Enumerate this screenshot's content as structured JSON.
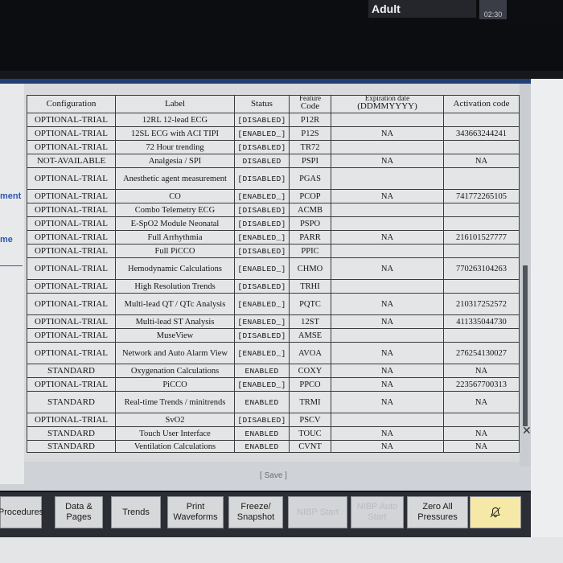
{
  "header": {
    "patient_type": "Adult",
    "clock": "02:30"
  },
  "left_pane": {
    "items": [
      "ment",
      "me"
    ]
  },
  "table": {
    "columns": [
      "Configuration",
      "Label",
      "Status",
      "Feature Code",
      "Expiration date (DDMMYYYY)",
      "Activation code"
    ],
    "column_display": {
      "configuration": "Configuration",
      "label": "Label",
      "status": "Status",
      "feature_code_top": "Feature",
      "feature_code_bottom": "Code",
      "expiration_top": "Expiration date",
      "expiration_bottom": "(DDMMYYYY)",
      "activation": "Activation code"
    },
    "rows": [
      {
        "config": "OPTIONAL-TRIAL",
        "label": "12RL 12-lead ECG",
        "status": "[DISABLED]",
        "code": "P12R",
        "expiration": "",
        "activation": ""
      },
      {
        "config": "OPTIONAL-TRIAL",
        "label": "12SL ECG with ACI TIPI",
        "status": "[ENABLED_]",
        "code": "P12S",
        "expiration": "NA",
        "activation": "343663244241"
      },
      {
        "config": "OPTIONAL-TRIAL",
        "label": "72 Hour trending",
        "status": "[DISABLED]",
        "code": "TR72",
        "expiration": "",
        "activation": ""
      },
      {
        "config": "NOT-AVAILABLE",
        "label": "Analgesia / SPI",
        "status": "DISABLED",
        "code": "PSPI",
        "expiration": "NA",
        "activation": "NA"
      },
      {
        "config": "OPTIONAL-TRIAL",
        "label": "Anesthetic agent measurement",
        "status": "[DISABLED]",
        "code": "PGAS",
        "expiration": "",
        "activation": ""
      },
      {
        "config": "OPTIONAL-TRIAL",
        "label": "CO",
        "status": "[ENABLED_]",
        "code": "PCOP",
        "expiration": "NA",
        "activation": "741772265105"
      },
      {
        "config": "OPTIONAL-TRIAL",
        "label": "Combo Telemetry ECG",
        "status": "[DISABLED]",
        "code": "ACMB",
        "expiration": "",
        "activation": ""
      },
      {
        "config": "OPTIONAL-TRIAL",
        "label": "E-SpO2 Module Neonatal",
        "status": "[DISABLED]",
        "code": "PSPO",
        "expiration": "",
        "activation": ""
      },
      {
        "config": "OPTIONAL-TRIAL",
        "label": "Full Arrhythmia",
        "status": "[ENABLED_]",
        "code": "PARR",
        "expiration": "NA",
        "activation": "216101527777"
      },
      {
        "config": "OPTIONAL-TRIAL",
        "label": "Full PiCCO",
        "status": "[DISABLED]",
        "code": "PPIC",
        "expiration": "",
        "activation": ""
      },
      {
        "config": "OPTIONAL-TRIAL",
        "label": "Hemodynamic Calculations",
        "status": "[ENABLED_]",
        "code": "CHMO",
        "expiration": "NA",
        "activation": "770263104263"
      },
      {
        "config": "OPTIONAL-TRIAL",
        "label": "High Resolution Trends",
        "status": "[DISABLED]",
        "code": "TRHI",
        "expiration": "",
        "activation": ""
      },
      {
        "config": "OPTIONAL-TRIAL",
        "label": "Multi-lead QT / QTc Analysis",
        "status": "[ENABLED_]",
        "code": "PQTC",
        "expiration": "NA",
        "activation": "210317252572"
      },
      {
        "config": "OPTIONAL-TRIAL",
        "label": "Multi-lead ST Analysis",
        "status": "[ENABLED_]",
        "code": "12ST",
        "expiration": "NA",
        "activation": "411335044730"
      },
      {
        "config": "OPTIONAL-TRIAL",
        "label": "MuseView",
        "status": "[DISABLED]",
        "code": "AMSE",
        "expiration": "",
        "activation": ""
      },
      {
        "config": "OPTIONAL-TRIAL",
        "label": "Network and Auto Alarm View",
        "status": "[ENABLED_]",
        "code": "AVOA",
        "expiration": "NA",
        "activation": "276254130027"
      },
      {
        "config": "STANDARD",
        "label": "Oxygenation Calculations",
        "status": "ENABLED",
        "code": "COXY",
        "expiration": "NA",
        "activation": "NA"
      },
      {
        "config": "OPTIONAL-TRIAL",
        "label": "PiCCO",
        "status": "[ENABLED_]",
        "code": "PPCO",
        "expiration": "NA",
        "activation": "223567700313"
      },
      {
        "config": "STANDARD",
        "label": "Real-time Trends / minitrends",
        "status": "ENABLED",
        "code": "TRMI",
        "expiration": "NA",
        "activation": "NA"
      },
      {
        "config": "OPTIONAL-TRIAL",
        "label": "SvO2",
        "status": "[DISABLED]",
        "code": "PSCV",
        "expiration": "",
        "activation": ""
      },
      {
        "config": "STANDARD",
        "label": "Touch User Interface",
        "status": "ENABLED",
        "code": "TOUC",
        "expiration": "NA",
        "activation": "NA"
      },
      {
        "config": "STANDARD",
        "label": "Ventilation Calculations",
        "status": "ENABLED",
        "code": "CVNT",
        "expiration": "NA",
        "activation": "NA"
      }
    ]
  },
  "save_label": "[ Save ]",
  "softkeys": [
    {
      "label": "Procedures",
      "disabled": false
    },
    {
      "label": "Data & Pages",
      "disabled": false
    },
    {
      "label": "Trends",
      "disabled": false
    },
    {
      "label": "Print Waveforms",
      "disabled": false
    },
    {
      "label": "Freeze/ Snapshot",
      "disabled": false
    },
    {
      "label": "NIBP Start",
      "disabled": true
    },
    {
      "label": "NIBP Auto Start",
      "disabled": true
    },
    {
      "label": "Zero All Pressures",
      "disabled": false
    },
    {
      "label": "",
      "disabled": false,
      "icon": "alarm-bell-icon"
    }
  ]
}
